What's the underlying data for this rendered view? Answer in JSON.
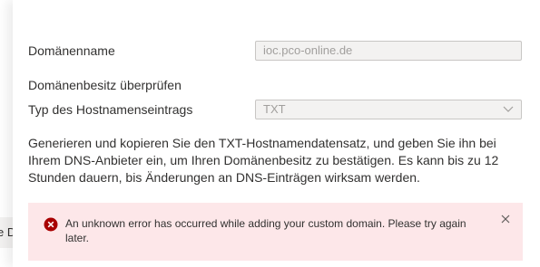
{
  "background_fragment": {
    "text": "e D"
  },
  "form": {
    "domain_name": {
      "label": "Domänenname",
      "value": "ioc.pco-online.de"
    },
    "verify_heading": "Domänenbesitz überprüfen",
    "record_type": {
      "label": "Typ des Hostnamenseintrags",
      "selected": "TXT"
    },
    "description": "Generieren und kopieren Sie den TXT-Hostnamendatensatz, und geben Sie ihn bei Ihrem DNS-Anbieter ein, um Ihren Domänenbesitz zu bestätigen. Es kann bis zu 12 Stunden dauern, bis Änderungen an DNS-Einträgen wirksam werden."
  },
  "error": {
    "message": "An unknown error has occurred while adding your custom domain. Please try again later.",
    "icon": "error-circle-icon",
    "close_icon": "close-icon"
  },
  "colors": {
    "error_bg": "#fde7e9",
    "error_icon": "#a80000",
    "input_bg": "#f3f2f1",
    "input_border": "#c8c6c4",
    "text": "#323130",
    "muted": "#a19f9d"
  }
}
